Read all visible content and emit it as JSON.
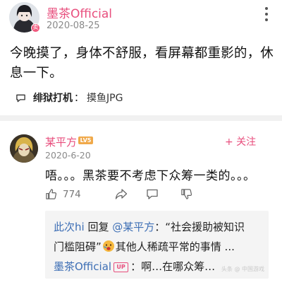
{
  "post": {
    "author": "墨茶Official",
    "date": "2020-08-25",
    "avatar_badge": "卖",
    "content": "今晚摸了，身体不舒服，看屏幕都重影的，休息一下。",
    "topic_name": "绯狱打机",
    "topic_sep": "：",
    "topic_text": "摸鱼JPG"
  },
  "comment": {
    "author": "某平方",
    "level": "LV5",
    "follow_label": "+ 关注",
    "date": "2020-6-20",
    "text": "唔。。。黑茶要不考虑下众筹一类的。。。",
    "like_count": "774"
  },
  "replies": {
    "line1_user": "此次hi",
    "line1_verb": " 回复 ",
    "line1_target": "@某平方",
    "line1_quote": "：“社会援助被知识",
    "line2_text_a": "门槛阻碍”",
    "line2_text_b": "其他人稀疏平常的事情 ...",
    "line3_user": "墨茶Official",
    "line3_badge": "UP",
    "line3_text": "：啊…在哪众筹…",
    "watermark": "头条 @ 中国游戏"
  },
  "colors": {
    "accent_pink": "#e84e7d",
    "link_blue": "#3e6fb5",
    "level_orange": "#f0a94a"
  },
  "icons": [
    "more-icon",
    "topic-icon",
    "like-icon",
    "share-icon",
    "comment-icon",
    "dislike-icon",
    "emoji-icon"
  ]
}
